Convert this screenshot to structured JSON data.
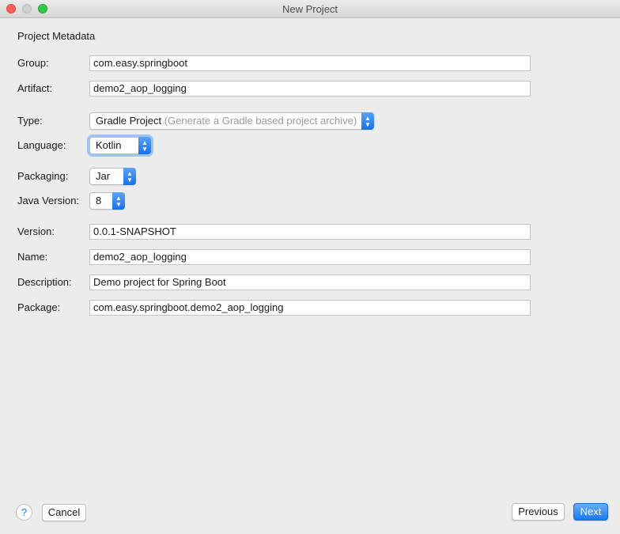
{
  "window": {
    "title": "New Project"
  },
  "section": {
    "title": "Project Metadata"
  },
  "fields": {
    "group": {
      "label": "Group:",
      "value": "com.easy.springboot"
    },
    "artifact": {
      "label": "Artifact:",
      "value": "demo2_aop_logging"
    },
    "type": {
      "label": "Type:",
      "value": "Gradle Project",
      "hint": "(Generate a Gradle based project archive)"
    },
    "language": {
      "label": "Language:",
      "value": "Kotlin"
    },
    "packaging": {
      "label": "Packaging:",
      "value": "Jar"
    },
    "java_version": {
      "label": "Java Version:",
      "value": "8"
    },
    "version": {
      "label": "Version:",
      "value": "0.0.1-SNAPSHOT"
    },
    "name": {
      "label": "Name:",
      "value": "demo2_aop_logging"
    },
    "description": {
      "label": "Description:",
      "value": "Demo project for Spring Boot"
    },
    "package": {
      "label": "Package:",
      "value": "com.easy.springboot.demo2_aop_logging"
    }
  },
  "footer": {
    "help": "?",
    "cancel": "Cancel",
    "previous": "Previous",
    "next": "Next"
  }
}
